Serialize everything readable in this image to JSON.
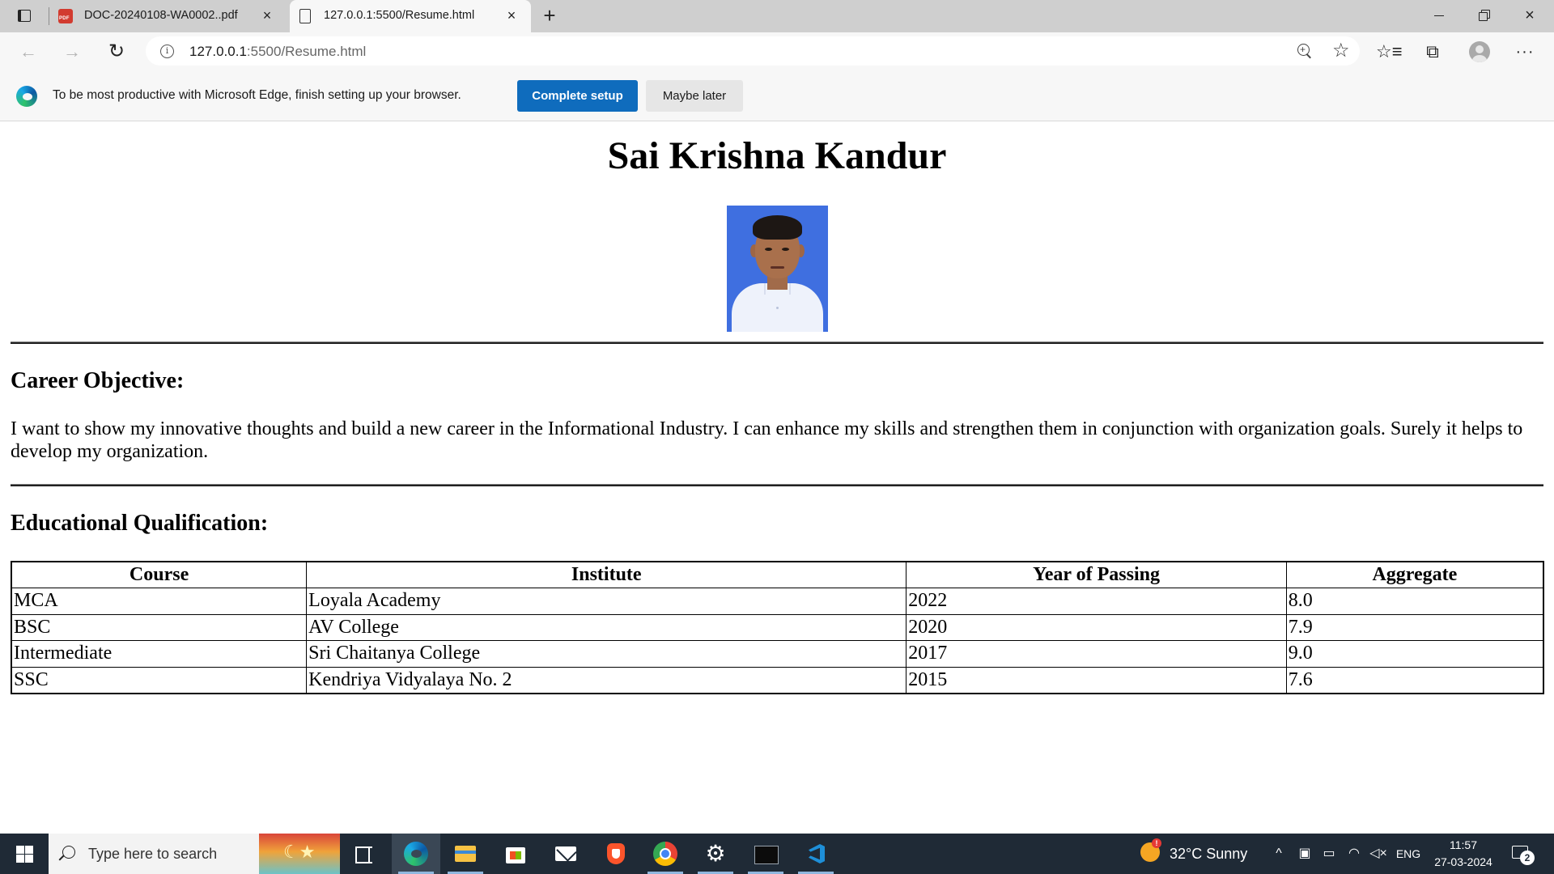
{
  "browser": {
    "tabs": [
      {
        "title": "DOC-20240108-WA0002..pdf",
        "icon": "pdf-icon",
        "active": false
      },
      {
        "title": "127.0.0.1:5500/Resume.html",
        "icon": "page-icon",
        "active": true
      }
    ],
    "address": {
      "host": "127.0.0.1",
      "path": ":5500/Resume.html"
    },
    "icons": {
      "back": "←",
      "forward": "→",
      "refresh": "↻",
      "info": "i",
      "favorites": "☆",
      "collections": "⧉",
      "menu": "···",
      "close": "×",
      "new_tab": "+"
    }
  },
  "notification": {
    "text": "To be most productive with Microsoft Edge, finish setting up your browser.",
    "primary_button": "Complete setup",
    "secondary_button": "Maybe later"
  },
  "resume": {
    "name": "Sai Krishna Kandur",
    "career_heading": "Career Objective:",
    "career_text": "I want to show my innovative thoughts and build a new career in the Informational Industry. I can enhance my skills and strengthen them in conjunction with organization goals. Surely it helps to develop my organization.",
    "education_heading": "Educational Qualification:",
    "education_columns": [
      "Course",
      "Institute",
      "Year of Passing",
      "Aggregate"
    ],
    "education_rows": [
      [
        "MCA",
        "Loyala Academy",
        "2022",
        "8.0"
      ],
      [
        "BSC",
        "AV College",
        "2020",
        "7.9"
      ],
      [
        "Intermediate",
        "Sri Chaitanya College",
        "2017",
        "9.0"
      ],
      [
        "SSC",
        "Kendriya Vidyalaya No. 2",
        "2015",
        "7.6"
      ]
    ]
  },
  "taskbar": {
    "search_placeholder": "Type here to search",
    "weather": "32°C  Sunny",
    "tray": {
      "chevron": "^",
      "language": "ENG"
    },
    "time": "11:57",
    "date": "27-03-2024",
    "notifications_count": "2",
    "settings_glyph": "⚙"
  },
  "colors": {
    "accent": "#0f6cbd",
    "taskbar": "#1f2a36",
    "photo_background": "#3f6fe0"
  }
}
